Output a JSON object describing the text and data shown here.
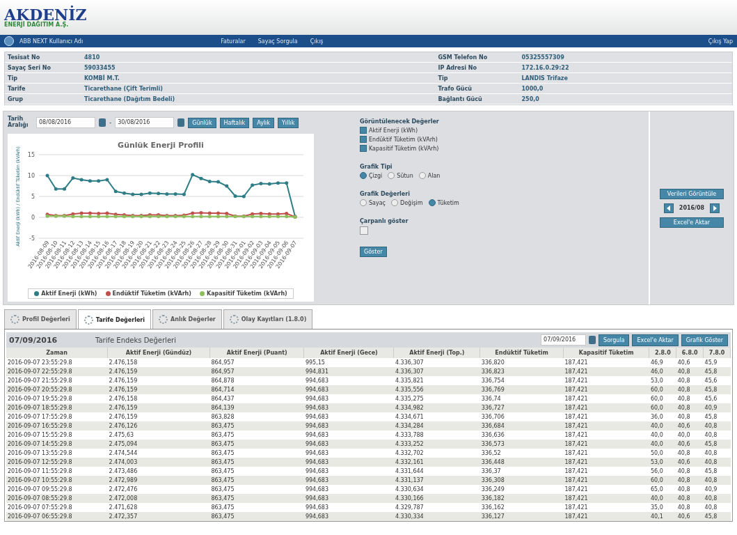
{
  "logo": {
    "line1": "AKDENİZ",
    "line2": "ENERJİ DAĞITIM A.Ş."
  },
  "navbar": {
    "user": "ABB NEXT Kullanıcı Adı",
    "links": [
      "Faturalar",
      "Sayaç Sorgula",
      "Çıkış"
    ],
    "right": "Çıkış Yap"
  },
  "info": {
    "left": [
      {
        "label": "Tesisat No",
        "value": "4810"
      },
      {
        "label": "Sayaç Seri No",
        "value": "59033455"
      },
      {
        "label": "Tip",
        "value": "KOMBİ M.T."
      },
      {
        "label": "Tarife",
        "value": "Ticarethane (Çift Terimli)"
      },
      {
        "label": "Grup",
        "value": "Ticarethane (Dağıtım Bedeli)"
      }
    ],
    "right": [
      {
        "label": "GSM Telefon No",
        "value": "05325557309"
      },
      {
        "label": "IP Adresi No",
        "value": "172.16.0.29:22"
      },
      {
        "label": "Tip",
        "value": "LANDIS Trifaze"
      },
      {
        "label": "Trafo Gücü",
        "value": "1000,0"
      },
      {
        "label": "Bağlantı Gücü",
        "value": "250,0"
      }
    ]
  },
  "filter": {
    "label": "Tarih Aralığı",
    "from": "08/08/2016",
    "separator": "-",
    "to": "30/08/2016",
    "buttons": [
      "Günlük",
      "Haftalık",
      "Aylık",
      "Yıllık"
    ]
  },
  "chart_data": {
    "type": "line",
    "grid": true,
    "legend": "bottom",
    "title": "Günlük Enerji Profili",
    "ylabel": "Aktif Enerji (kWh) / Endüktif Tüketim (kVArh)",
    "ylim": [
      -5,
      15
    ],
    "yticks": [
      -5,
      0,
      5,
      10,
      15
    ],
    "categories": [
      "2016-08-09",
      "2016-08-10",
      "2016-08-11",
      "2016-08-12",
      "2016-08-13",
      "2016-08-14",
      "2016-08-15",
      "2016-08-16",
      "2016-08-17",
      "2016-08-18",
      "2016-08-19",
      "2016-08-20",
      "2016-08-21",
      "2016-08-22",
      "2016-08-23",
      "2016-08-24",
      "2016-08-25",
      "2016-08-26",
      "2016-08-27",
      "2016-08-28",
      "2016-08-29",
      "2016-08-30",
      "2016-08-31",
      "2016-09-01",
      "2016-09-02",
      "2016-09-03",
      "2016-09-04",
      "2016-09-05",
      "2016-09-06",
      "2016-09-07"
    ],
    "series": [
      {
        "name": "Aktif Enerji (kWh)",
        "color": "#2e7d86",
        "values": [
          10,
          6.8,
          6.8,
          9.4,
          9,
          8.7,
          8.7,
          9,
          6.2,
          5.8,
          5.5,
          5.5,
          5.8,
          5.7,
          5.6,
          5.6,
          5.5,
          10.2,
          9.3,
          8.6,
          8.5,
          7.5,
          5.1,
          5,
          7.7,
          8.1,
          8,
          8.2,
          8.2,
          0.2
        ]
      },
      {
        "name": "Endüktif Tüketim (kVArh)",
        "color": "#c0504d",
        "values": [
          0.7,
          0.4,
          0.4,
          0.8,
          1,
          1,
          0.9,
          1,
          0.7,
          0.6,
          0.4,
          0.4,
          0.6,
          0.6,
          0.4,
          0.4,
          0.5,
          1,
          1.1,
          1,
          1,
          0.9,
          0.3,
          0.3,
          0.8,
          0.9,
          0.8,
          0.8,
          0.9,
          0.1
        ]
      },
      {
        "name": "Kapasitif Tüketim (kVArh)",
        "color": "#8bbf5a",
        "values": [
          0.3,
          0.3,
          0.3,
          0.2,
          0.2,
          0.2,
          0.2,
          0.2,
          0.2,
          0.2,
          0.2,
          0.2,
          0.2,
          0.2,
          0.2,
          0.2,
          0.2,
          0.2,
          0.2,
          0.2,
          0.2,
          0.2,
          0.2,
          0.2,
          0.2,
          0.2,
          0.2,
          0.2,
          0.2,
          0.1
        ]
      }
    ]
  },
  "options": {
    "values_title": "Görüntülenecek Değerler",
    "values": [
      {
        "label": "Aktif Enerji (kWh)",
        "checked": true
      },
      {
        "label": "Endüktif Tüketim (kVArh)",
        "checked": true
      },
      {
        "label": "Kapasitif Tüketim (kVArh)",
        "checked": true
      }
    ],
    "type_title": "Grafik Tipi",
    "types": [
      {
        "label": "Çizgi",
        "selected": true
      },
      {
        "label": "Sütun",
        "selected": false
      },
      {
        "label": "Alan",
        "selected": false
      }
    ],
    "mode_title": "Grafik Değerleri",
    "modes": [
      {
        "label": "Sayaç",
        "selected": false
      },
      {
        "label": "Değişim",
        "selected": false
      },
      {
        "label": "Tüketim",
        "selected": true
      }
    ],
    "multiplier_title": "Çarpanlı göster",
    "multiplier": false,
    "apply": "Göster"
  },
  "side": {
    "view": "Verileri Görüntüle",
    "period": "2016/08",
    "export": "Excel'e Aktar"
  },
  "tabs": [
    {
      "label": "Profil Değerleri",
      "selected": false
    },
    {
      "label": "Tarife Değerleri",
      "selected": true
    },
    {
      "label": "Anlık Değerler",
      "selected": false
    },
    {
      "label": "Olay Kayıtları (1.8.0)",
      "selected": false
    }
  ],
  "table": {
    "date": "07/09/2016",
    "title": "Tarife Endeks Değerleri",
    "query_date": "07/09/2016",
    "buttons": [
      "Sorgula",
      "Excel'e Aktar",
      "Grafik Göster"
    ],
    "columns": [
      "Zaman",
      "Aktif Enerji (Gündüz)",
      "Aktif Enerji (Puant)",
      "Aktif Enerji (Gece)",
      "Aktif Enerji (Top.)",
      "Endüktif Tüketim",
      "Kapasitif Tüketim",
      "2.8.0",
      "6.8.0",
      "7.8.0"
    ],
    "rows": [
      [
        "2016-09-07 23:55:29.8",
        "2.476,158",
        "864,957",
        "995,15",
        "4.336,307",
        "336,820",
        "187,421",
        "46,9",
        "40,6",
        "45,9"
      ],
      [
        "2016-09-07 22:55:29.8",
        "2.476,159",
        "864,957",
        "994,831",
        "4.336,307",
        "336,823",
        "187,421",
        "46,0",
        "40,8",
        "45,8"
      ],
      [
        "2016-09-07 21:55:29.8",
        "2.476,159",
        "864,878",
        "994,683",
        "4.335,821",
        "336,754",
        "187,421",
        "53,0",
        "40,8",
        "45,6"
      ],
      [
        "2016-09-07 20:55:29.8",
        "2.476,159",
        "864,714",
        "994,683",
        "4.335,556",
        "336,769",
        "187,421",
        "60,0",
        "40,8",
        "45,8"
      ],
      [
        "2016-09-07 19:55:29.8",
        "2.476,158",
        "864,437",
        "994,683",
        "4.335,275",
        "336,74",
        "187,421",
        "60,0",
        "40,8",
        "45,6"
      ],
      [
        "2016-09-07 18:55:29.8",
        "2.476,159",
        "864,139",
        "994,683",
        "4.334,982",
        "336,727",
        "187,421",
        "60,0",
        "40,8",
        "40,9"
      ],
      [
        "2016-09-07 17:55:29.8",
        "2.476,159",
        "863,828",
        "994,683",
        "4.334,671",
        "336,706",
        "187,421",
        "36,0",
        "40,8",
        "45,8"
      ],
      [
        "2016-09-07 16:55:29.8",
        "2.476,126",
        "863,475",
        "994,683",
        "4.334,284",
        "336,684",
        "187,421",
        "40,0",
        "40,6",
        "40,8"
      ],
      [
        "2016-09-07 15:55:29.8",
        "2.475,63",
        "863,475",
        "994,683",
        "4.333,788",
        "336,636",
        "187,421",
        "40,0",
        "40,0",
        "40,8"
      ],
      [
        "2016-09-07 14:55:29.8",
        "2.475,094",
        "863,475",
        "994,683",
        "4.333,252",
        "336,573",
        "187,421",
        "40,0",
        "40,6",
        "45,8"
      ],
      [
        "2016-09-07 13:55:29.8",
        "2.474,544",
        "863,475",
        "994,683",
        "4.332,702",
        "336,52",
        "187,421",
        "50,0",
        "40,8",
        "40,8"
      ],
      [
        "2016-09-07 12:55:29.8",
        "2.474,003",
        "863,475",
        "994,683",
        "4.332,161",
        "336,448",
        "187,421",
        "53,0",
        "40,6",
        "40,8"
      ],
      [
        "2016-09-07 11:55:29.8",
        "2.473,486",
        "863,475",
        "994,683",
        "4.331,644",
        "336,37",
        "187,421",
        "56,0",
        "40,8",
        "45,8"
      ],
      [
        "2016-09-07 10:55:29.8",
        "2.472,989",
        "863,475",
        "994,683",
        "4.331,137",
        "336,308",
        "187,421",
        "60,0",
        "40,8",
        "40,8"
      ],
      [
        "2016-09-07 09:55:29.8",
        "2.472,476",
        "863,475",
        "994,683",
        "4.330,634",
        "336,249",
        "187,421",
        "65,0",
        "40,8",
        "40,9"
      ],
      [
        "2016-09-07 08:55:29.8",
        "2.472,008",
        "863,475",
        "994,683",
        "4.330,166",
        "336,182",
        "187,421",
        "40,0",
        "40,8",
        "40,8"
      ],
      [
        "2016-09-07 07:55:29.8",
        "2.471,628",
        "863,475",
        "994,683",
        "4.329,787",
        "336,162",
        "187,421",
        "35,0",
        "40,8",
        "40,8"
      ],
      [
        "2016-09-07 06:55:29.8",
        "2.472,357",
        "863,475",
        "994,683",
        "4.330,334",
        "336,127",
        "187,421",
        "40,1",
        "40,6",
        "45,8"
      ]
    ]
  }
}
